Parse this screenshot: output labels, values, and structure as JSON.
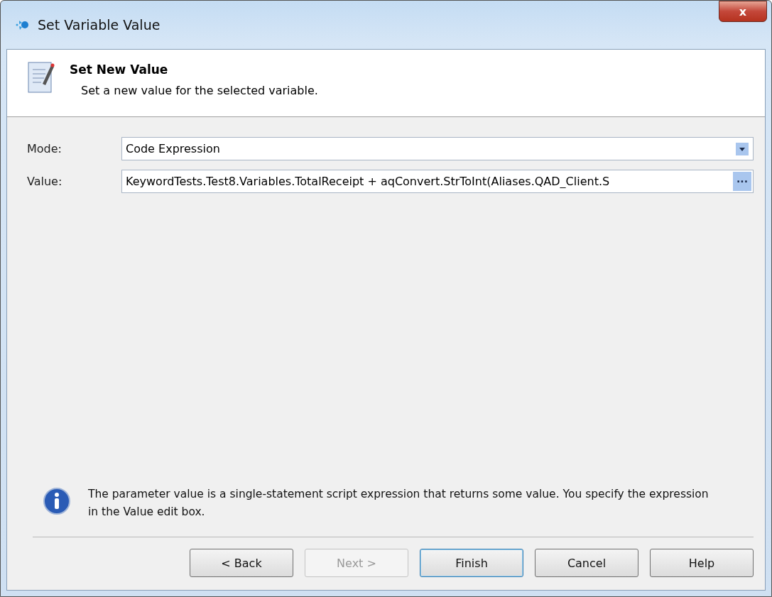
{
  "window": {
    "title": "Set Variable Value",
    "close_label": "x"
  },
  "header": {
    "title": "Set New Value",
    "subtitle": "Set a new value for the selected variable."
  },
  "fields": [
    {
      "kind": "dropdown",
      "label": "Mode:",
      "value": "Code Expression"
    },
    {
      "kind": "ellipsis",
      "label": "Value:",
      "value": "KeywordTests.Test8.Variables.TotalReceipt +  aqConvert.StrToInt(Aliases.QAD_Client.S",
      "button": "···"
    }
  ],
  "info": "The parameter value is a single-statement script expression that returns some value. You specify the expression in the Value edit box.",
  "buttons": [
    {
      "label": "< Back",
      "disabled": false,
      "default": false
    },
    {
      "label": "Next >",
      "disabled": true,
      "default": false
    },
    {
      "label": "Finish",
      "disabled": false,
      "default": true
    },
    {
      "label": "Cancel",
      "disabled": false,
      "default": false
    },
    {
      "label": "Help",
      "disabled": false,
      "default": false
    }
  ]
}
